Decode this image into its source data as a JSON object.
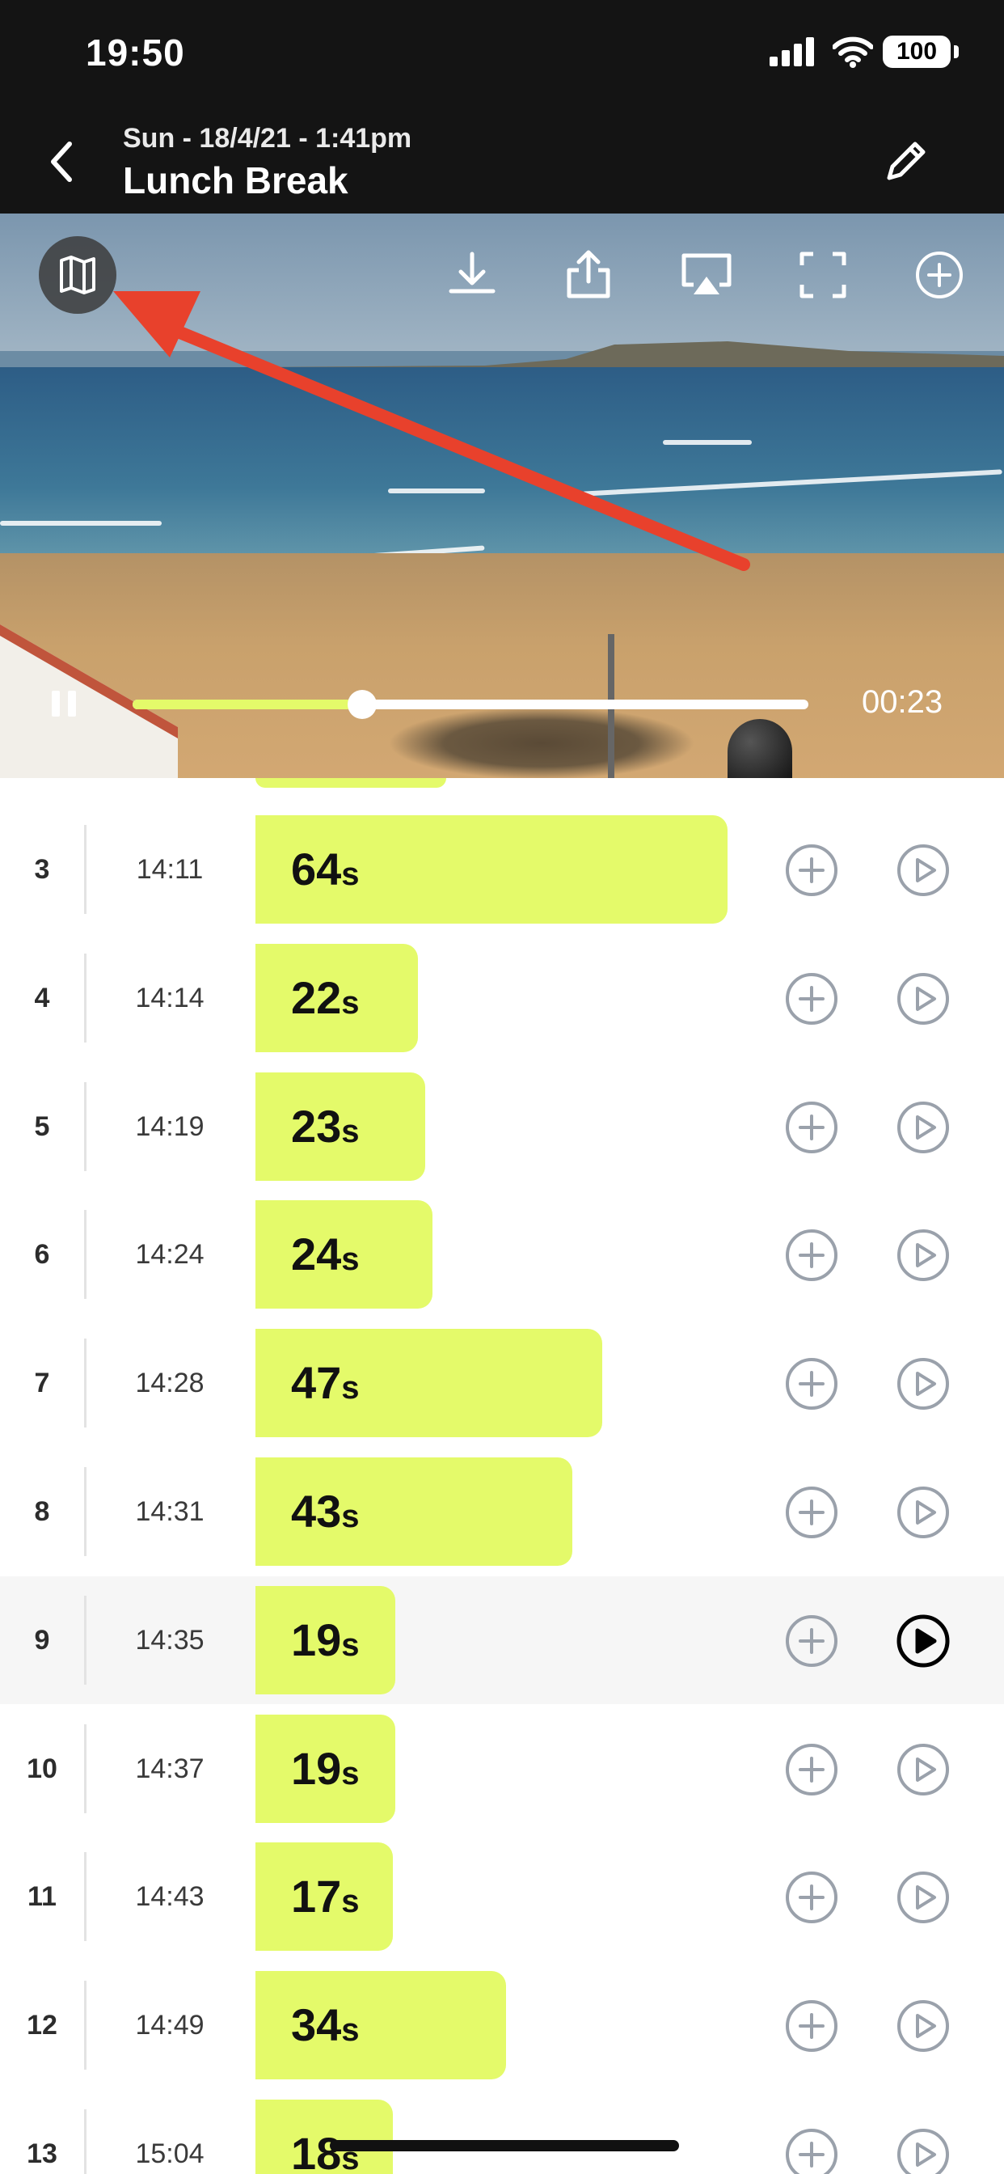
{
  "status_bar": {
    "time": "19:50",
    "battery": "100"
  },
  "header": {
    "subtitle": "Sun - 18/4/21 - 1:41pm",
    "title": "Lunch Break"
  },
  "player": {
    "timecode": "00:23",
    "progress_fraction": 0.34,
    "toolbar_icons": [
      "map-icon",
      "download-icon",
      "share-icon",
      "airplay-icon",
      "fullscreen-icon",
      "add-circle-icon"
    ]
  },
  "rows": [
    {
      "index": "3",
      "time": "14:11",
      "duration": "64",
      "unit": "s",
      "seconds": 64,
      "selected": false
    },
    {
      "index": "4",
      "time": "14:14",
      "duration": "22",
      "unit": "s",
      "seconds": 22,
      "selected": false
    },
    {
      "index": "5",
      "time": "14:19",
      "duration": "23",
      "unit": "s",
      "seconds": 23,
      "selected": false
    },
    {
      "index": "6",
      "time": "14:24",
      "duration": "24",
      "unit": "s",
      "seconds": 24,
      "selected": false
    },
    {
      "index": "7",
      "time": "14:28",
      "duration": "47",
      "unit": "s",
      "seconds": 47,
      "selected": false
    },
    {
      "index": "8",
      "time": "14:31",
      "duration": "43",
      "unit": "s",
      "seconds": 43,
      "selected": false
    },
    {
      "index": "9",
      "time": "14:35",
      "duration": "19",
      "unit": "s",
      "seconds": 19,
      "selected": true
    },
    {
      "index": "10",
      "time": "14:37",
      "duration": "19",
      "unit": "s",
      "seconds": 19,
      "selected": false
    },
    {
      "index": "11",
      "time": "14:43",
      "duration": "17",
      "unit": "s",
      "seconds": 17,
      "selected": false
    },
    {
      "index": "12",
      "time": "14:49",
      "duration": "34",
      "unit": "s",
      "seconds": 34,
      "selected": false
    },
    {
      "index": "13",
      "time": "15:04",
      "duration": "18",
      "unit": "s",
      "seconds": 18,
      "selected": false
    }
  ],
  "colors": {
    "accent": "#e4fa6a",
    "header_bg": "#141414",
    "icon_gray": "#9aa1ab",
    "annotation_arrow": "#e8412c"
  }
}
